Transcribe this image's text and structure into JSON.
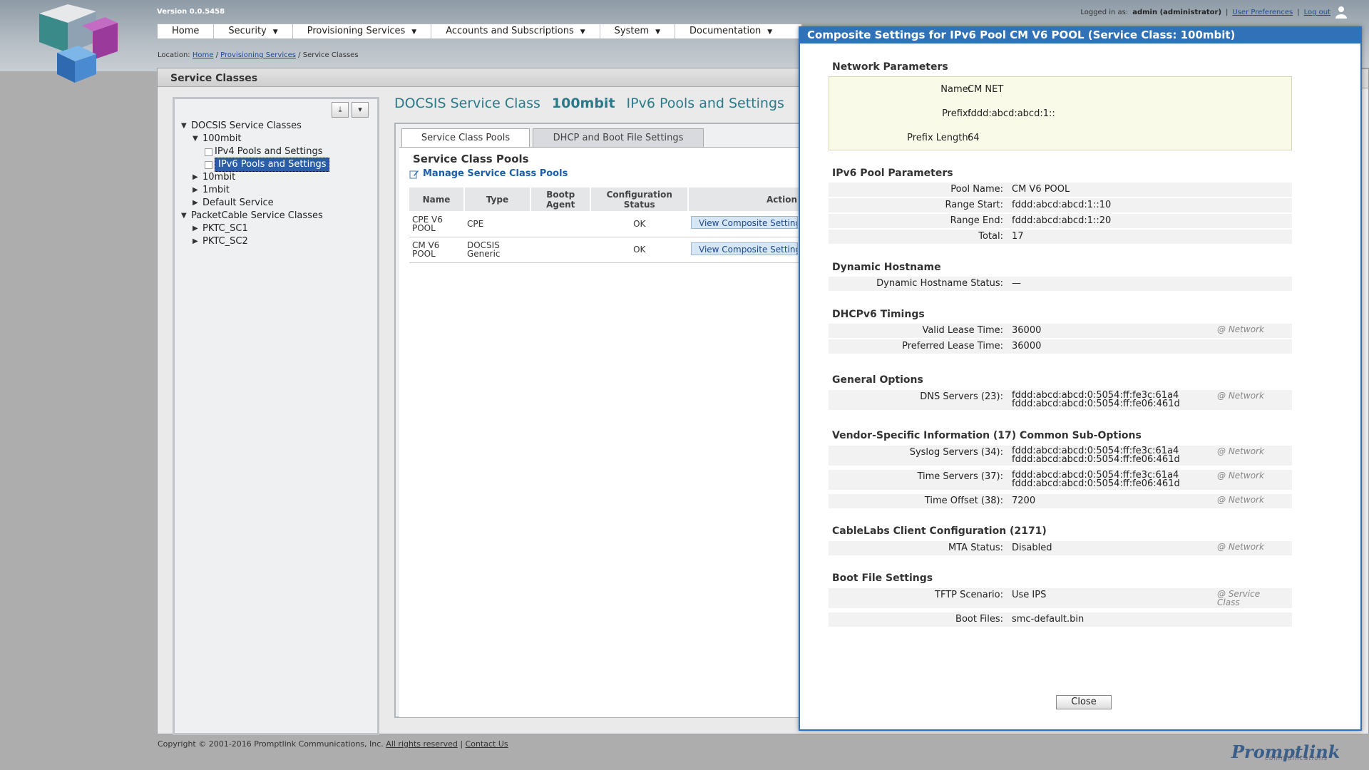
{
  "header": {
    "version": "Version 0.0.5458",
    "logged_in_label": "Logged in as:",
    "user": "admin (administrator)",
    "user_prefs": "User Preferences",
    "logout": "Log out",
    "sep1": "|",
    "sep2": "|"
  },
  "nav": {
    "home": "Home",
    "security": "Security",
    "provisioning": "Provisioning Services",
    "accounts": "Accounts and Subscriptions",
    "system": "System",
    "documentation": "Documentation"
  },
  "breadcrumb": {
    "prefix": "Location:",
    "home": "Home",
    "sep1": "/",
    "provisioning": "Provisioning Services",
    "sep2": "/",
    "current": "Service Classes"
  },
  "page": {
    "header": "Service Classes"
  },
  "tree": {
    "docsis": "DOCSIS Service Classes",
    "c100mbit": "100mbit",
    "ipv4": "IPv4 Pools and Settings",
    "ipv6": "IPv6 Pools and Settings",
    "c10mbit": "10mbit",
    "c1mbit": "1mbit",
    "default": "Default Service",
    "packetcable": "PacketCable Service Classes",
    "pktc1": "PKTC_SC1",
    "pktc2": "PKTC_SC2"
  },
  "content": {
    "title_a": "DOCSIS Service Class",
    "title_b": "100mbit",
    "title_c": "IPv6 Pools and Settings",
    "tab_pools": "Service Class Pools",
    "tab_dhcp": "DHCP and Boot File Settings",
    "pools_heading": "Service Class Pools",
    "manage_link": "Manage Service Class Pools",
    "columns": [
      "Name",
      "Type",
      "Bootp Agent",
      "Configuration Status",
      "Action"
    ],
    "rows": [
      {
        "name": "CPE V6 POOL",
        "type": "CPE",
        "bootp": "",
        "status": "OK",
        "action": "View Composite Settings"
      },
      {
        "name": "CM V6 POOL",
        "type": "DOCSIS Generic",
        "bootp": "",
        "status": "OK",
        "action": "View Composite Settings"
      }
    ]
  },
  "footer": {
    "copyright": "Copyright © 2001-2016 Promptlink Communications, Inc.",
    "rights": "All rights reserved",
    "sep": "|",
    "contact": "Contact Us",
    "logo": "Promptlink",
    "logo_sub": "communications"
  },
  "modal": {
    "title": "Composite Settings for IPv6 Pool CM V6 POOL (Service Class: 100mbit)",
    "network_params": "Network Parameters",
    "net_name_label": "Name:",
    "net_name": "CM NET",
    "net_prefix_label": "Prefix:",
    "net_prefix": "fddd:abcd:abcd:1::",
    "net_prefixlen_label": "Prefix Length:",
    "net_prefixlen": "64",
    "pool_params": "IPv6 Pool Parameters",
    "pool_name_label": "Pool Name:",
    "pool_name": "CM V6 POOL",
    "range_start_label": "Range Start:",
    "range_start": "fddd:abcd:abcd:1::10",
    "range_end_label": "Range End:",
    "range_end": "fddd:abcd:abcd:1::20",
    "total_label": "Total:",
    "total": "17",
    "dyn_host": "Dynamic Hostname",
    "dyn_status_label": "Dynamic Hostname Status:",
    "dyn_status": "—",
    "dhcpv6": "DHCPv6 Timings",
    "valid_label": "Valid Lease Time:",
    "valid": "36000",
    "valid_scope": "@ Network",
    "pref_label": "Preferred Lease Time:",
    "pref": "36000",
    "general": "General Options",
    "dns_label": "DNS Servers (23):",
    "dns1": "fddd:abcd:abcd:0:5054:ff:fe3c:61a4",
    "dns2": "fddd:abcd:abcd:0:5054:ff:fe06:461d",
    "dns_scope": "@ Network",
    "vendor": "Vendor-Specific Information (17) Common Sub-Options",
    "syslog_label": "Syslog Servers (34):",
    "syslog1": "fddd:abcd:abcd:0:5054:ff:fe3c:61a4",
    "syslog2": "fddd:abcd:abcd:0:5054:ff:fe06:461d",
    "syslog_scope": "@ Network",
    "time_label": "Time Servers (37):",
    "time1": "fddd:abcd:abcd:0:5054:ff:fe3c:61a4",
    "time2": "fddd:abcd:abcd:0:5054:ff:fe06:461d",
    "time_scope": "@ Network",
    "offset_label": "Time Offset (38):",
    "offset": "7200",
    "offset_scope": "@ Network",
    "cablelabs": "CableLabs Client Configuration (2171)",
    "mta_label": "MTA Status:",
    "mta": "Disabled",
    "mta_scope": "@ Network",
    "boot": "Boot File Settings",
    "tftp_label": "TFTP Scenario:",
    "tftp": "Use IPS",
    "tftp_scope1": "@ Service",
    "tftp_scope2": "Class",
    "bootfile_label": "Boot Files:",
    "bootfile": "smc-default.bin",
    "close": "Close"
  },
  "colors": {
    "modal_title_bg": "#2f72b8",
    "selected_tree": "#2a5ea8",
    "title_teal": "#2a7a8a",
    "link_blue": "#1d5ea8"
  }
}
